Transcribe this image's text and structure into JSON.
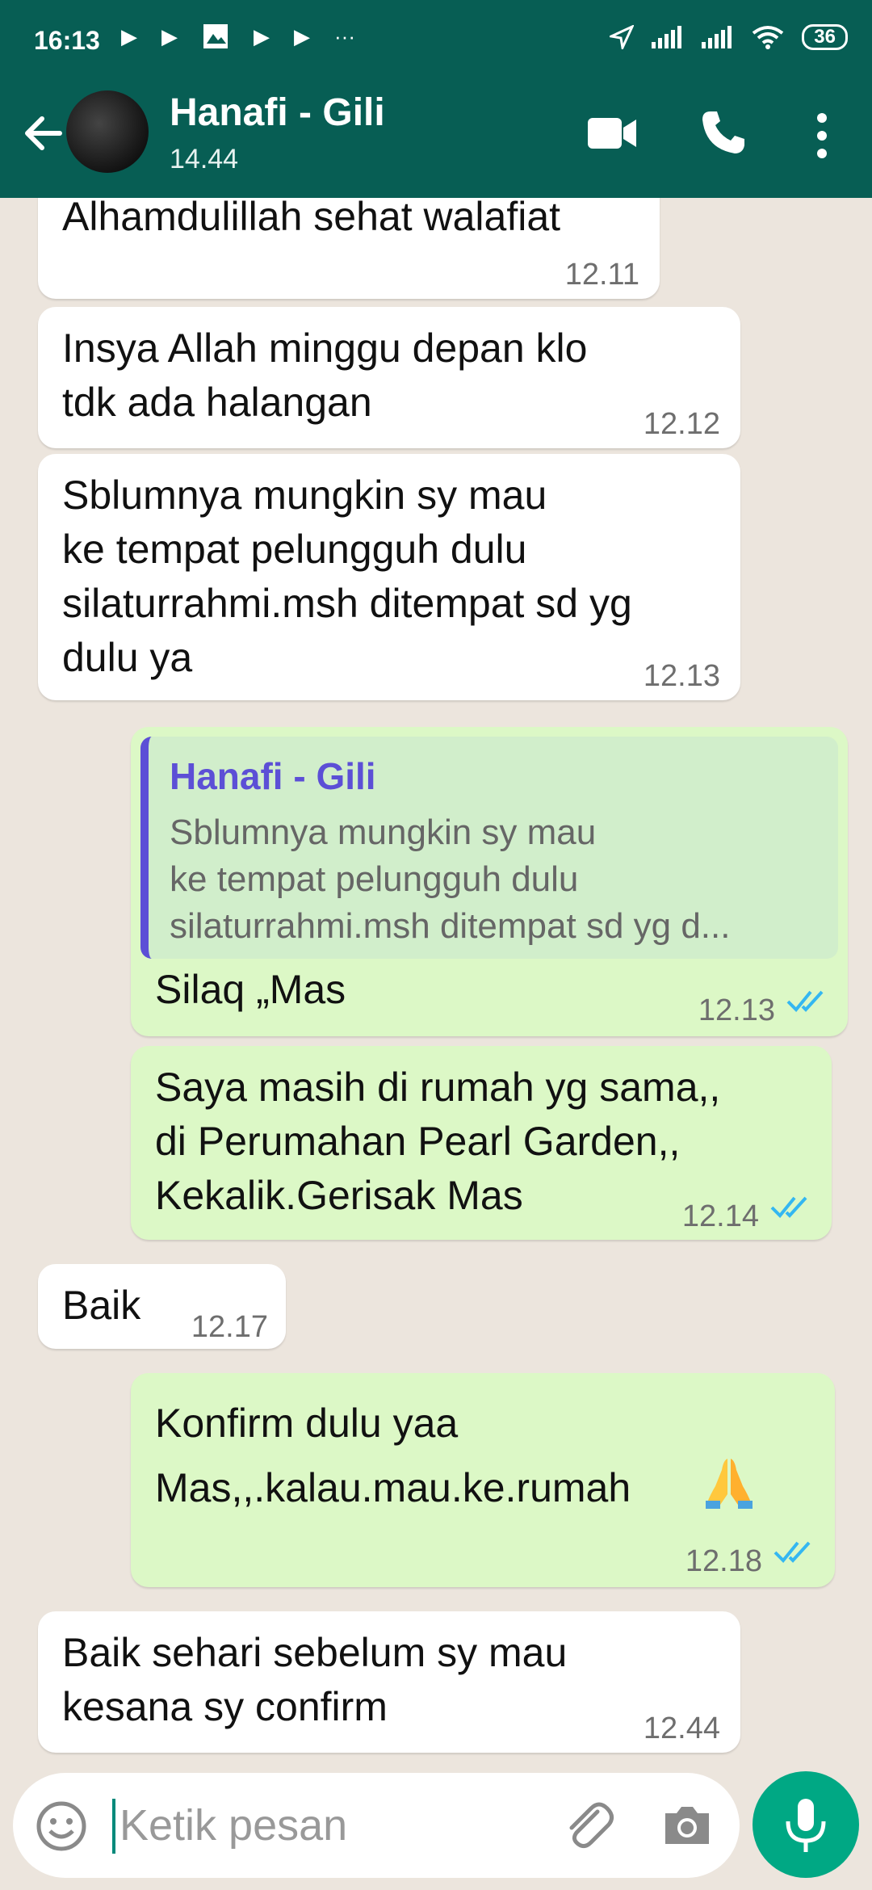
{
  "status_bar": {
    "time": "16:13",
    "battery": "36",
    "left_icons": [
      "play-icon",
      "play-icon",
      "photo-icon",
      "play-icon",
      "play-icon",
      "more-dots"
    ],
    "right_icons": [
      "location-icon",
      "signal-icon",
      "signal-icon",
      "wifi-icon",
      "battery-icon"
    ]
  },
  "header": {
    "contact_name": "Hanafi - Gili",
    "last_seen": "14.44",
    "background_color": "#075e54",
    "icons": [
      "back-arrow-icon",
      "video-call-icon",
      "phone-icon",
      "more-vert-icon"
    ]
  },
  "messages": [
    {
      "direction": "in",
      "text": "Alhamdulillah sehat walafiat",
      "time": "12.11"
    },
    {
      "direction": "in",
      "text": "Insya Allah minggu depan klo\ntdk ada halangan",
      "time": "12.12"
    },
    {
      "direction": "in",
      "text": "Sblumnya mungkin sy mau\nke tempat pelungguh dulu\nsilaturrahmi.msh ditempat sd yg\ndulu ya",
      "time": "12.13"
    },
    {
      "direction": "out",
      "quote": {
        "name": "Hanafi - Gili",
        "text": "Sblumnya mungkin sy mau\nke tempat pelungguh dulu\nsilaturrahmi.msh ditempat sd yg d..."
      },
      "text": "Silaq „Mas",
      "time": "12.13",
      "status": "read"
    },
    {
      "direction": "out",
      "text": "Saya masih di rumah yg sama,,\ndi Perumahan Pearl Garden,,\nKekalik.Gerisak Mas",
      "time": "12.14",
      "status": "read"
    },
    {
      "direction": "in",
      "text": "Baik",
      "time": "12.17"
    },
    {
      "direction": "out",
      "text": "Konfirm dulu yaa\nMas,,.kalau.mau.ke.rumah",
      "emoji": "folded-hands",
      "time": "12.18",
      "status": "read"
    },
    {
      "direction": "in",
      "text": "Baik sehari sebelum sy mau\nkesana sy confirm",
      "time": "12.44"
    }
  ],
  "composer": {
    "placeholder": "Ketik pesan",
    "icons": [
      "emoji-icon",
      "attach-icon",
      "camera-icon",
      "mic-icon"
    ]
  },
  "colors": {
    "header": "#075e54",
    "incoming": "#ffffff",
    "outgoing": "#dcf8c6",
    "quote_accent": "#5c4fd6",
    "read_ticks": "#34b7f1",
    "mic_button": "#00a884"
  }
}
